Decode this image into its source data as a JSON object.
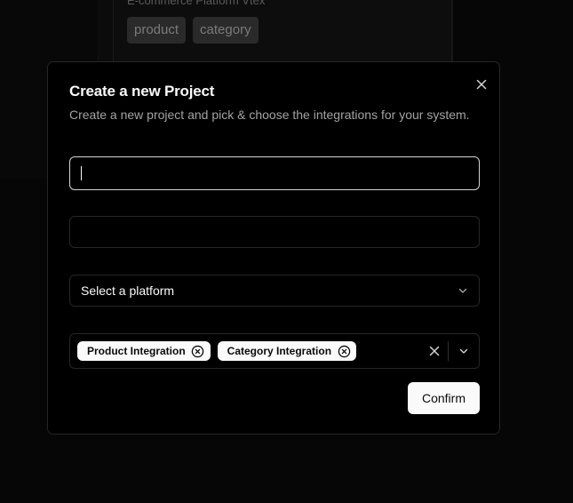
{
  "background": {
    "card_title": "E-commerce Platform Vtex",
    "tags": [
      "product",
      "category"
    ]
  },
  "modal": {
    "title": "Create a new Project",
    "description": "Create a new project and pick & choose the integrations for your system.",
    "name_input": {
      "value": "",
      "placeholder": ""
    },
    "second_input": {
      "value": "",
      "placeholder": ""
    },
    "platform_select": {
      "selected": "Select a platform"
    },
    "integrations": {
      "selected": [
        "Product Integration",
        "Category Integration"
      ]
    },
    "confirm_label": "Confirm"
  },
  "icons": {
    "close": "close-icon",
    "chevron": "chevron-down-icon",
    "chip_remove": "circle-x-icon",
    "clear": "close-icon"
  },
  "colors": {
    "background": "#060606",
    "modal_bg": "#000000",
    "border": "#262626",
    "text": "#fafafa",
    "muted": "#a3a3a3",
    "button_bg": "#fafafa"
  }
}
